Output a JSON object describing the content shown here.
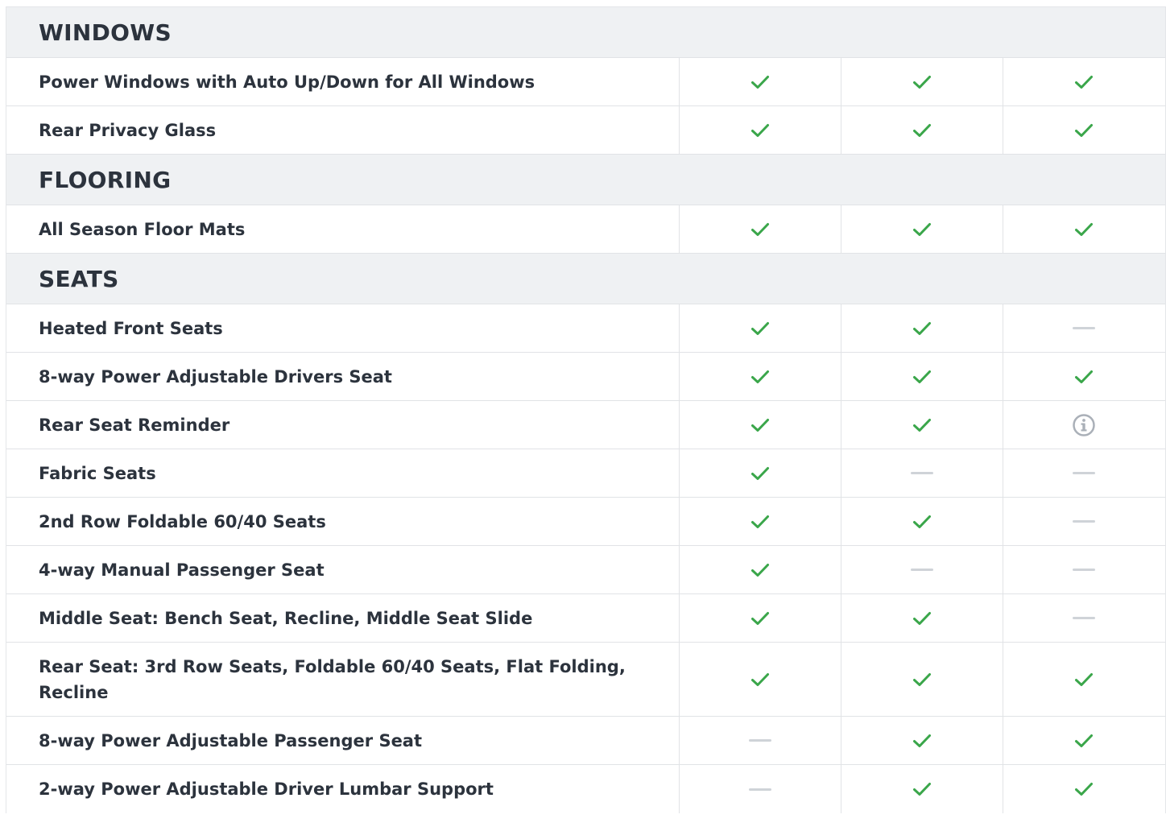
{
  "colors": {
    "check": "#3aa64a",
    "dash": "#cfd3d8",
    "info": "#aab0b8",
    "header_bg": "#eff1f3",
    "text": "#2c333d"
  },
  "sections": [
    {
      "title": "WINDOWS",
      "rows": [
        {
          "label": "Power Windows with Auto Up/Down for All Windows",
          "values": [
            "check",
            "check",
            "check"
          ]
        },
        {
          "label": "Rear Privacy Glass",
          "values": [
            "check",
            "check",
            "check"
          ]
        }
      ]
    },
    {
      "title": "FLOORING",
      "rows": [
        {
          "label": "All Season Floor Mats",
          "values": [
            "check",
            "check",
            "check"
          ]
        }
      ]
    },
    {
      "title": "SEATS",
      "rows": [
        {
          "label": "Heated Front Seats",
          "values": [
            "check",
            "check",
            "dash"
          ]
        },
        {
          "label": "8-way Power Adjustable Drivers Seat",
          "values": [
            "check",
            "check",
            "check"
          ]
        },
        {
          "label": "Rear Seat Reminder",
          "values": [
            "check",
            "check",
            "info"
          ]
        },
        {
          "label": "Fabric Seats",
          "values": [
            "check",
            "dash",
            "dash"
          ]
        },
        {
          "label": "2nd Row Foldable 60/40 Seats",
          "values": [
            "check",
            "check",
            "dash"
          ]
        },
        {
          "label": "4-way Manual Passenger Seat",
          "values": [
            "check",
            "dash",
            "dash"
          ]
        },
        {
          "label": "Middle Seat: Bench Seat, Recline, Middle Seat Slide",
          "values": [
            "check",
            "check",
            "dash"
          ]
        },
        {
          "label": "Rear Seat: 3rd Row Seats, Foldable 60/40 Seats, Flat Folding, Recline",
          "values": [
            "check",
            "check",
            "check"
          ]
        },
        {
          "label": "8-way Power Adjustable Passenger Seat",
          "values": [
            "dash",
            "check",
            "check"
          ]
        },
        {
          "label": "2-way Power Adjustable Driver Lumbar Support",
          "values": [
            "dash",
            "check",
            "check"
          ]
        }
      ]
    }
  ]
}
